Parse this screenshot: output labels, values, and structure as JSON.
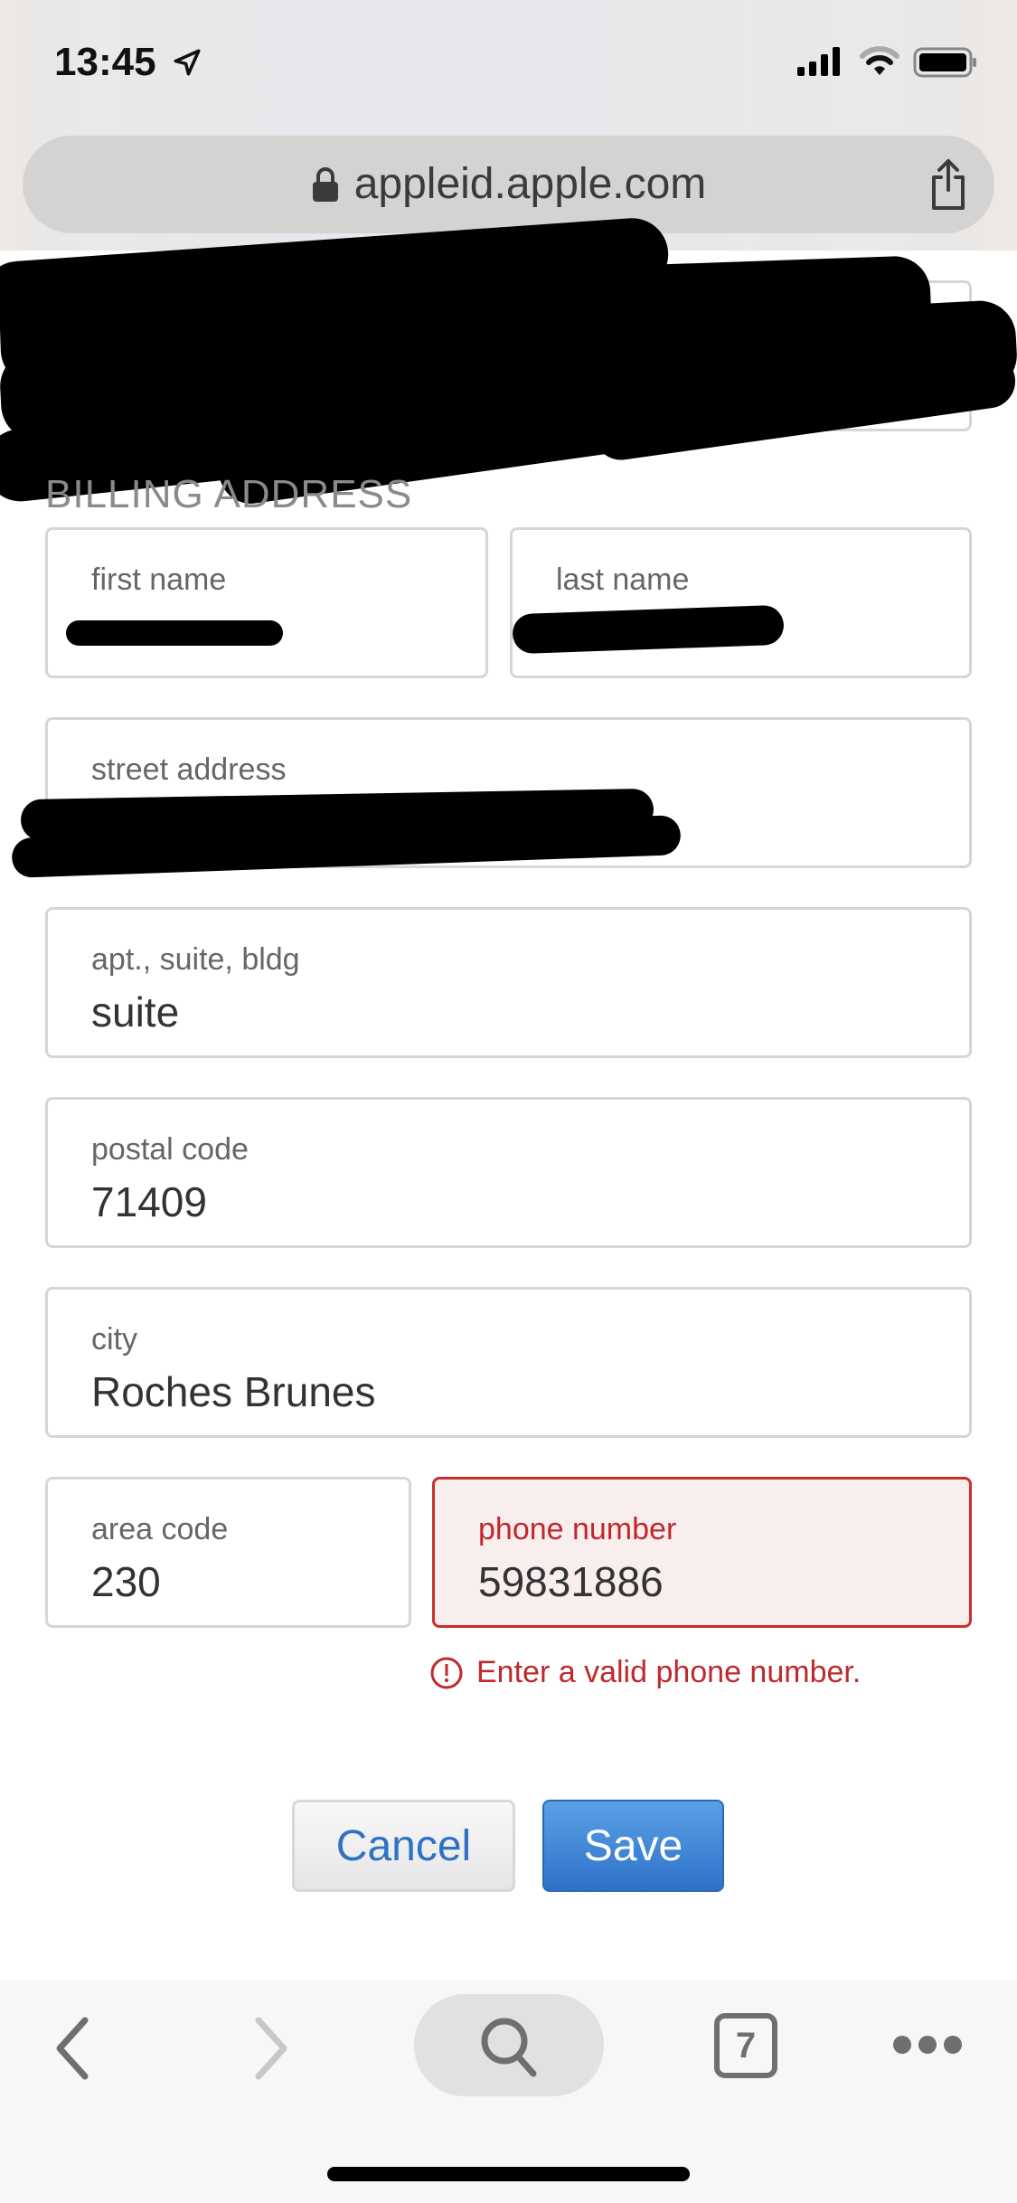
{
  "status_bar": {
    "time": "13:45",
    "icons": [
      "location-arrow-icon",
      "signal-icon",
      "wifi-icon",
      "battery-icon"
    ]
  },
  "browser": {
    "url": "appleid.apple.com",
    "icons": [
      "lock-icon",
      "share-icon"
    ]
  },
  "section_title": "BILLING ADDRESS",
  "fields": {
    "first_name": {
      "label": "first name"
    },
    "last_name": {
      "label": "last name"
    },
    "street": {
      "label": "street address"
    },
    "apt": {
      "label": "apt., suite, bldg",
      "value": "suite"
    },
    "postal": {
      "label": "postal code",
      "value": "71409"
    },
    "city": {
      "label": "city",
      "value": "Roches Brunes"
    },
    "area_code": {
      "label": "area code",
      "value": "230"
    },
    "phone": {
      "label": "phone number",
      "value": "59831886",
      "error": "Enter a valid phone number."
    }
  },
  "buttons": {
    "cancel": "Cancel",
    "save": "Save"
  },
  "toolbar": {
    "tabs_count": "7",
    "icons": [
      "back-icon",
      "forward-icon",
      "search-icon",
      "tabs-icon",
      "more-icon"
    ]
  },
  "colors": {
    "error": "#c0282b",
    "accent": "#2f72c9"
  }
}
